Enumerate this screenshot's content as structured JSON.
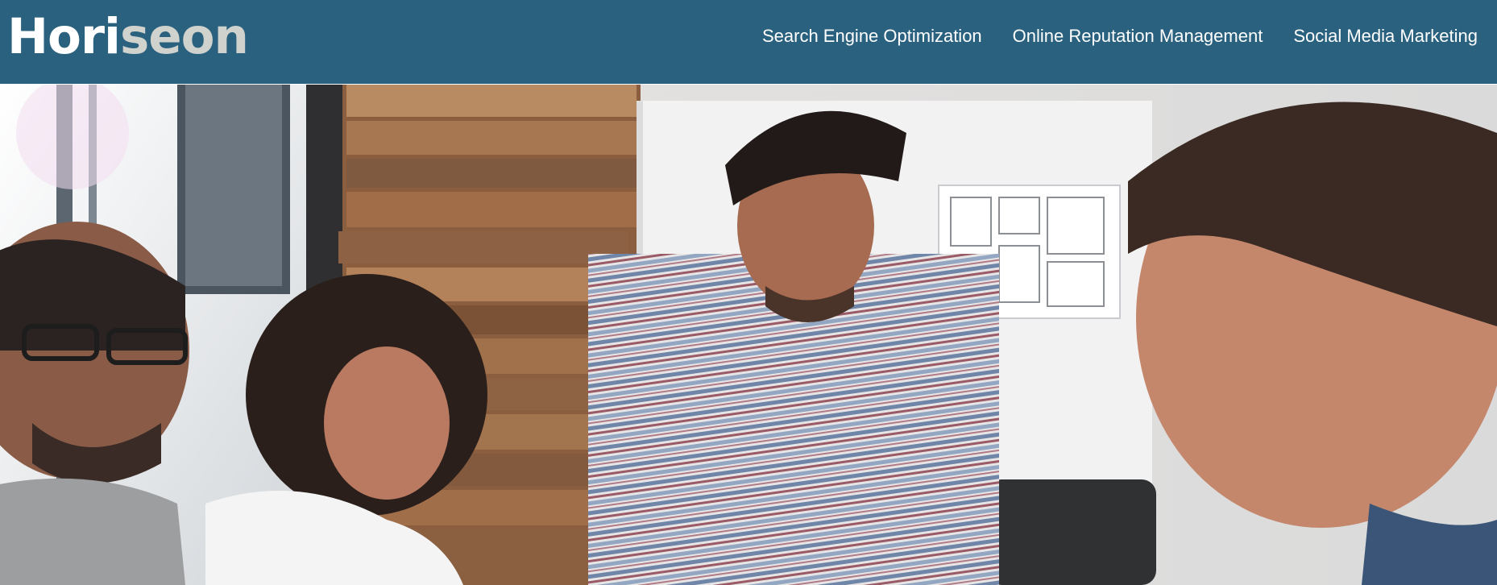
{
  "header": {
    "logo": {
      "part1": "Hori",
      "part2": "seon"
    },
    "nav": [
      {
        "label": "Search Engine Optimization"
      },
      {
        "label": "Online Reputation Management"
      },
      {
        "label": "Social Media Marketing"
      }
    ]
  },
  "colors": {
    "brand": "#2a617f",
    "logo_accent": "#d0d2cd",
    "nav_text": "#ffffff"
  },
  "icons": [
    "hero-image"
  ]
}
